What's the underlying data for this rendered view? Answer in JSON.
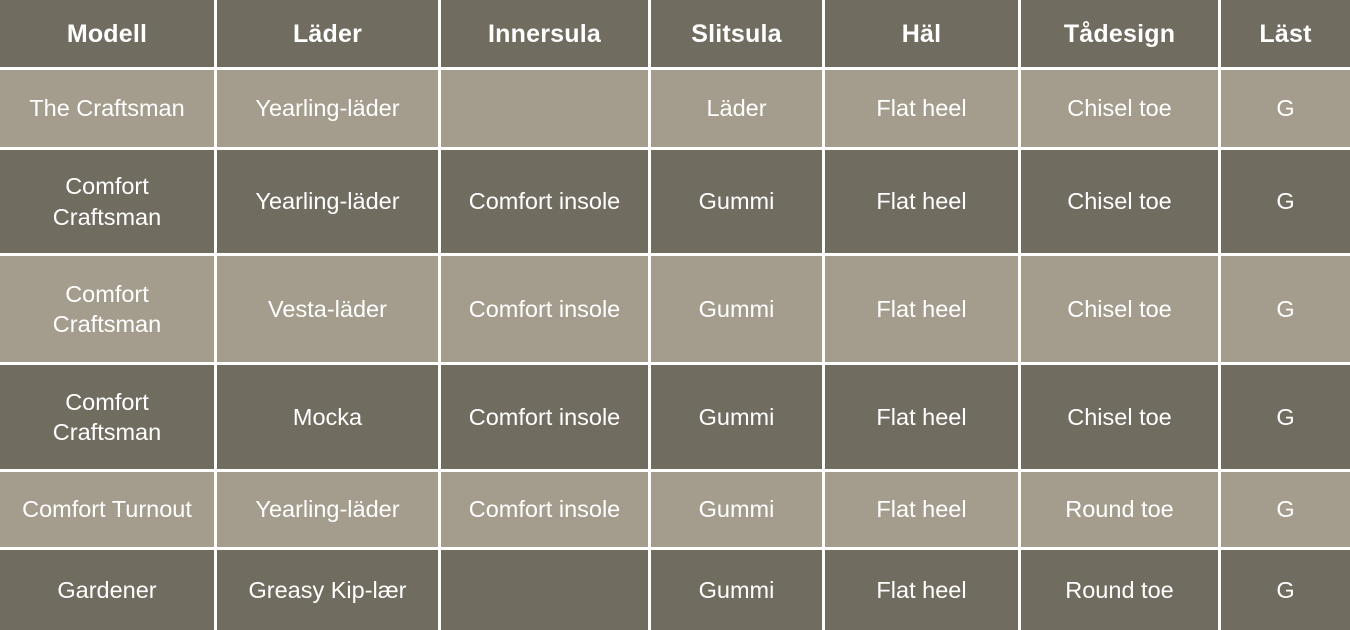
{
  "table": {
    "name": "shoe-model-specification-table",
    "colors": {
      "row_dark": "#716C60",
      "row_light": "#A49D8D",
      "gridline": "#FFFFFF",
      "text": "#FFFFFF"
    },
    "columns": [
      {
        "key": "modell",
        "label": "Modell"
      },
      {
        "key": "lader",
        "label": "Läder"
      },
      {
        "key": "innersula",
        "label": "Innersula"
      },
      {
        "key": "slitsula",
        "label": "Slitsula"
      },
      {
        "key": "hal",
        "label": "Häl"
      },
      {
        "key": "tadesign",
        "label": "Tådesign"
      },
      {
        "key": "last",
        "label": "Läst"
      }
    ],
    "rows": [
      {
        "shade": "light",
        "modell": "The Craftsman",
        "lader": "Yearling-läder",
        "innersula": "",
        "slitsula": "Läder",
        "hal": "Flat heel",
        "tadesign": "Chisel toe",
        "last": "G"
      },
      {
        "shade": "dark",
        "modell": "Comfort\nCraftsman",
        "lader": "Yearling-läder",
        "innersula": "Comfort insole",
        "slitsula": "Gummi",
        "hal": "Flat heel",
        "tadesign": "Chisel toe",
        "last": "G"
      },
      {
        "shade": "light",
        "modell": "Comfort\nCraftsman",
        "lader": "Vesta-läder",
        "innersula": "Comfort insole",
        "slitsula": "Gummi",
        "hal": "Flat heel",
        "tadesign": "Chisel toe",
        "last": "G"
      },
      {
        "shade": "dark",
        "modell": "Comfort\nCraftsman",
        "lader": "Mocka",
        "innersula": "Comfort insole",
        "slitsula": "Gummi",
        "hal": "Flat heel",
        "tadesign": "Chisel toe",
        "last": "G"
      },
      {
        "shade": "light",
        "modell": "Comfort Turnout",
        "lader": "Yearling-läder",
        "innersula": "Comfort insole",
        "slitsula": "Gummi",
        "hal": "Flat heel",
        "tadesign": "Round toe",
        "last": "G"
      },
      {
        "shade": "dark",
        "modell": "Gardener",
        "lader": "Greasy Kip-lær",
        "innersula": "",
        "slitsula": "Gummi",
        "hal": "Flat heel",
        "tadesign": "Round toe",
        "last": "G"
      }
    ]
  }
}
